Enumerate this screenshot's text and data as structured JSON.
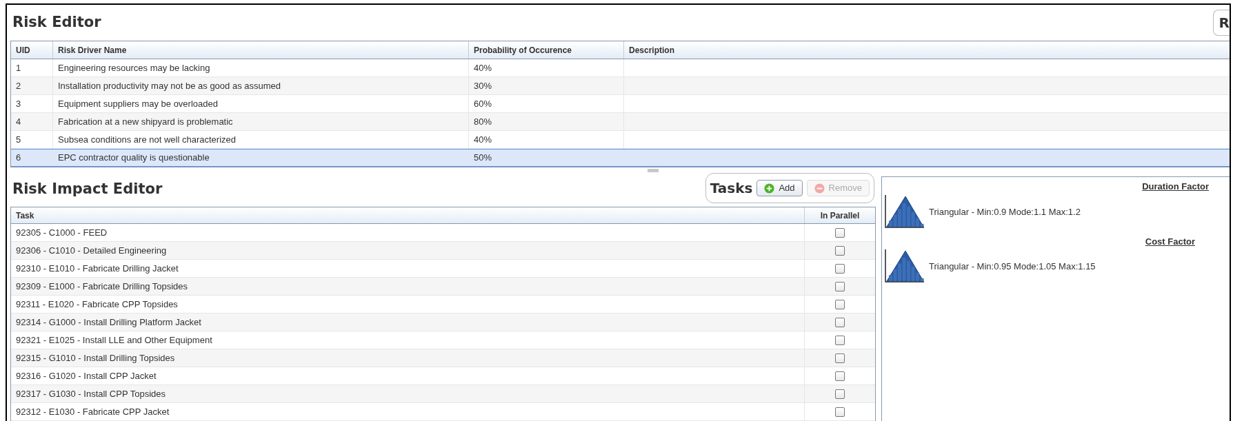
{
  "risk_editor": {
    "title": "Risk Editor",
    "corner_tab": "R",
    "columns": [
      "UID",
      "Risk Driver Name",
      "Probability of Occurence",
      "Description"
    ],
    "rows": [
      {
        "uid": "1",
        "name": "Engineering resources may be lacking",
        "probability": "40%",
        "selected": false
      },
      {
        "uid": "2",
        "name": "Installation productivity may not be as good as assumed",
        "probability": "30%",
        "selected": false
      },
      {
        "uid": "3",
        "name": "Equipment suppliers may be overloaded",
        "probability": "60%",
        "selected": false
      },
      {
        "uid": "4",
        "name": "Fabrication at a new shipyard is problematic",
        "probability": "80%",
        "selected": false
      },
      {
        "uid": "5",
        "name": "Subsea conditions are not well characterized",
        "probability": "40%",
        "selected": false
      },
      {
        "uid": "6",
        "name": "EPC contractor quality is questionable",
        "probability": "50%",
        "selected": true
      }
    ]
  },
  "risk_impact_editor": {
    "title": "Risk Impact Editor",
    "tasks_toolbar": {
      "label": "Tasks",
      "buttons": [
        {
          "label": "Add",
          "kind": "add",
          "disabled": false
        },
        {
          "label": "Remove",
          "kind": "remove",
          "disabled": true
        }
      ]
    },
    "columns": [
      "Task",
      "In Parallel"
    ],
    "rows": [
      {
        "task": "92305 - C1000 - FEED",
        "checked": false
      },
      {
        "task": "92306 - C1010 - Detailed Engineering",
        "checked": false
      },
      {
        "task": "92310 - E1010 - Fabricate Drilling Jacket",
        "checked": false
      },
      {
        "task": "92309 - E1000 - Fabricate Drilling Topsides",
        "checked": false
      },
      {
        "task": "92311 - E1020 - Fabricate CPP Topsides",
        "checked": false
      },
      {
        "task": "92314 - G1000 - Install Drilling Platform Jacket",
        "checked": false
      },
      {
        "task": "92321 - E1025 - Install LLE and Other Equipment",
        "checked": false
      },
      {
        "task": "92315 - G1010 - Install Drilling Topsides",
        "checked": false
      },
      {
        "task": "92316 - G1020 - Install CPP Jacket",
        "checked": false
      },
      {
        "task": "92317 - G1030 - Install CPP Topsides",
        "checked": false
      },
      {
        "task": "92312 - E1030 - Fabricate CPP Jacket",
        "checked": false
      }
    ],
    "factors": [
      {
        "title": "Duration Factor",
        "distribution": "Triangular - Min:0.9 Mode:1.1 Max:1.2"
      },
      {
        "title": "Cost Factor",
        "distribution": "Triangular - Min:0.95 Mode:1.05 Max:1.15"
      }
    ]
  }
}
